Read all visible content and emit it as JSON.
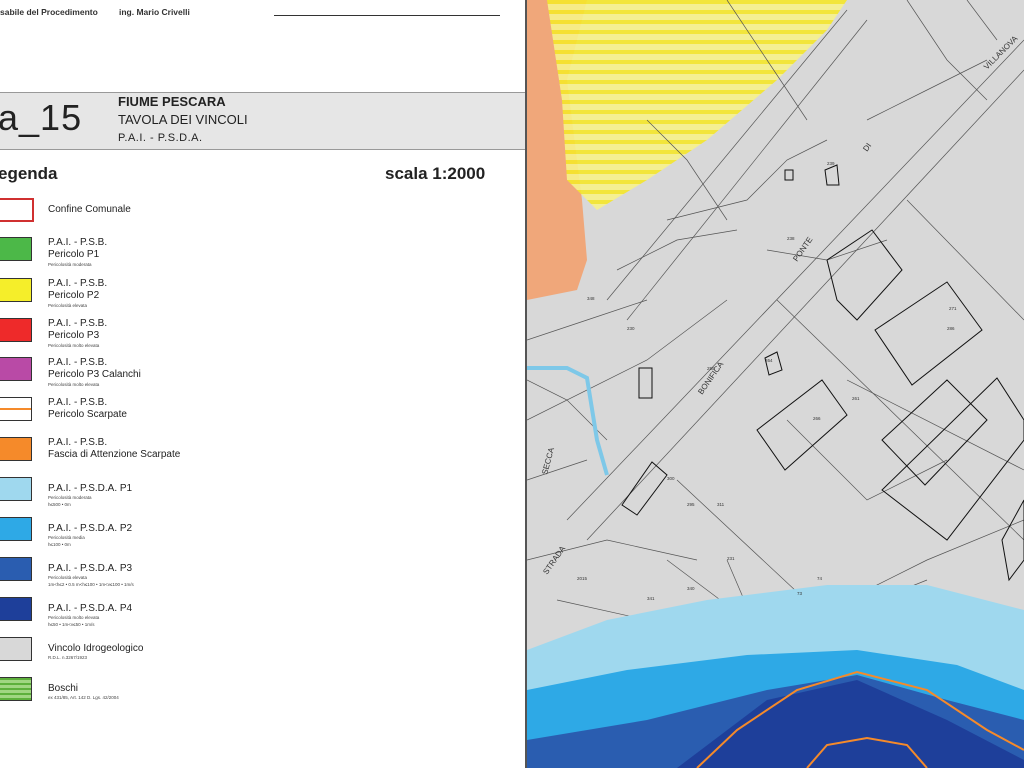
{
  "header": {
    "responsible": "sabile del Procedimento",
    "engineer": "ing. Mario Crivelli"
  },
  "title_block": {
    "code": "a_15",
    "line1": "FIUME PESCARA",
    "line2": "TAVOLA DEI VINCOLI",
    "line3": "P.A.I. - P.S.D.A."
  },
  "legend": {
    "heading": "egenda",
    "scale": "scala 1:2000",
    "items": [
      {
        "name": "confine-comunale",
        "line1": "Confine Comunale",
        "line2": "",
        "note1": "",
        "note2": "",
        "color": "#ffffff",
        "border": "#d03030",
        "pattern": "outline"
      },
      {
        "name": "psb-p1",
        "line1": "P.A.I. - P.S.B.",
        "line2": "Pericolo P1",
        "note1": "Pericolosità moderata",
        "note2": "",
        "color": "#4cb848",
        "border": "#333",
        "pattern": "solid"
      },
      {
        "name": "psb-p2",
        "line1": "P.A.I. - P.S.B.",
        "line2": "Pericolo P2",
        "note1": "Pericolosità elevata",
        "note2": "",
        "color": "#f5ee2a",
        "border": "#333",
        "pattern": "solid"
      },
      {
        "name": "psb-p3",
        "line1": "P.A.I. - P.S.B.",
        "line2": "Pericolo P3",
        "note1": "Pericolosità molto elevata",
        "note2": "",
        "color": "#ee2a2a",
        "border": "#333",
        "pattern": "solid"
      },
      {
        "name": "psb-p3-calanchi",
        "line1": "P.A.I. - P.S.B.",
        "line2": "Pericolo P3 Calanchi",
        "note1": "Pericolosità molto elevata",
        "note2": "",
        "color": "#b94aa6",
        "border": "#333",
        "pattern": "solid"
      },
      {
        "name": "psb-scarpate",
        "line1": "P.A.I. - P.S.B.",
        "line2": "Pericolo Scarpate",
        "note1": "",
        "note2": "",
        "color": "#ffffff",
        "border": "#333",
        "pattern": "line"
      },
      {
        "name": "psb-fascia",
        "line1": "P.A.I. - P.S.B.",
        "line2": "Fascia di Attenzione Scarpate",
        "note1": "",
        "note2": "",
        "color": "#f58a2a",
        "border": "#333",
        "pattern": "solid"
      },
      {
        "name": "psda-p1",
        "line1": "P.A.I. - P.S.D.A. P1",
        "line2": "",
        "note1": "Pericolosità moderata",
        "note2": "h≤500 • 0m",
        "color": "#9fd8ee",
        "border": "#333",
        "pattern": "solid"
      },
      {
        "name": "psda-p2",
        "line1": "P.A.I. - P.S.D.A. P2",
        "line2": "",
        "note1": "Pericolosità media",
        "note2": "h≤100 • 0m",
        "color": "#2ea9e6",
        "border": "#333",
        "pattern": "solid"
      },
      {
        "name": "psda-p3",
        "line1": "P.A.I. - P.S.D.A.  P3",
        "line2": "",
        "note1": "Pericolosità elevata",
        "note2": "1m<h≤2 • 0.5 m<h≤100 • 1m<v≤100 • 1m/s",
        "color": "#2a5db0",
        "border": "#333",
        "pattern": "solid"
      },
      {
        "name": "psda-p4",
        "line1": "P.A.I. - P.S.D.A.  P4",
        "line2": "",
        "note1": "Pericolosità molto elevata",
        "note2": "h≤50 • 1m<v≤50 • 1m/s",
        "color": "#1e3f9a",
        "border": "#333",
        "pattern": "solid"
      },
      {
        "name": "vincolo-idrogeologico",
        "line1": "Vincolo Idrogeologico",
        "line2": "",
        "note1": "R.D.L. n.3267/1923",
        "note2": "",
        "color": "#d8d8d8",
        "border": "#333",
        "pattern": "solid"
      },
      {
        "name": "boschi",
        "line1": "Boschi",
        "line2": "",
        "note1": "ex 431/85, Art. 142 D. Lgs. 42/2004",
        "note2": "",
        "color": "#bfe3a8",
        "border": "#333",
        "pattern": "hatch"
      }
    ]
  },
  "map_labels": {
    "road1": "PONTE",
    "road2": "BONIFICA",
    "road3": "STRADA",
    "road4": "SECCA",
    "road5": "VILLANOVA",
    "road6": "DI"
  },
  "parcels": [
    "238",
    "286",
    "239",
    "261",
    "271",
    "266",
    "264",
    "255",
    "295",
    "300",
    "311",
    "231",
    "340",
    "341",
    "348",
    "230",
    "2015",
    "74",
    "73"
  ],
  "colors": {
    "zone_p2": "#f5ee2a",
    "fascia": "#f58a2a",
    "p1": "#9fd8ee",
    "p2": "#2ea9e6",
    "p3": "#2a5db0",
    "p4": "#1e3f9a",
    "vincolo": "#d8d8d8"
  }
}
